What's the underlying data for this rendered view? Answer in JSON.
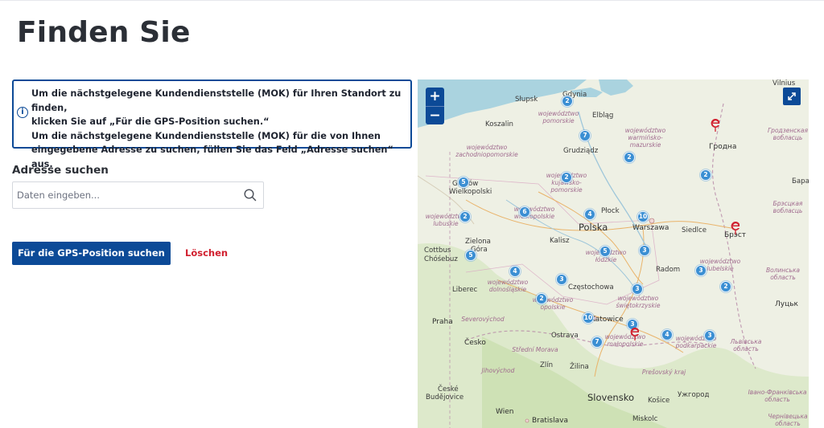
{
  "page": {
    "title": "Finden Sie"
  },
  "info": {
    "line1": "Um die nächstgelegene Kundendienststelle (MOK) für Ihren Standort zu finden,",
    "line2": "klicken Sie auf „Für die GPS-Position suchen.“",
    "line3": "Um die nächstgelegene Kundendienststelle (MOK) für die von Ihnen",
    "line4": "eingegebene Adresse zu suchen, füllen Sie das Feld „Adresse suchen“ aus."
  },
  "search": {
    "label": "Adresse suchen",
    "placeholder": "Daten eingeben..."
  },
  "actions": {
    "gps_label": "Für die GPS-Position suchen",
    "clear_label": "Löschen"
  },
  "map": {
    "zoom_in": "+",
    "zoom_out": "−",
    "labels": {
      "vilnius": "Vilnius",
      "gdynia": "Gdynia",
      "slupsk": "Słupsk",
      "elblag": "Elbląg",
      "koszalin": "Koszalin",
      "grodno": "Гродна",
      "grudziadz": "Grudziądz",
      "gorzow": "Gorzów",
      "wielkopolski": "Wielkopolski",
      "plock": "Płock",
      "polska": "Polska",
      "warszawa": "Warszawa",
      "siedlce": "Siedlce",
      "brest": "Брэст",
      "kalisz": "Kalisz",
      "zielona": "Zielona",
      "gora": "Góra",
      "cottbus": "Cottbus",
      "chosebuz": "Chóśebuz",
      "radom": "Radom",
      "liberec": "Liberec",
      "czestochowa": "Częstochowa",
      "lutsk": "Луцьк",
      "praha": "Praha",
      "katowice": "Katowice",
      "ostrava": "Ostrava",
      "cesko": "Česko",
      "zilina": "Žilina",
      "zlin": "Zlín",
      "slovensko": "Slovensko",
      "kosice": "Košice",
      "uzhhorod": "Ужгород",
      "ceske": "České",
      "budejovice": "Budějovice",
      "wien": "Wien",
      "bratislava": "Bratislava",
      "miskolc": "Miskolc",
      "bara": "Бара",
      "r_pomorskie": "województwo pomorskie",
      "r_warminsko": "województwo warmińsko-mazurskie",
      "r_zachodnio": "województwo zachodniopomorskie",
      "r_kujawsko": "województwo kujawsko-pomorskie",
      "r_lubuskie": "województwo lubuskie",
      "r_wielkopolskie": "województwo wielkopolskie",
      "r_lodzkie": "województwo łódzkie",
      "r_dolnoslaskie": "województwo dolnośląskie",
      "r_opolskie": "województwo opolskie",
      "r_swietokrzyskie": "województwo świętokrzyskie",
      "r_lubelskie": "województwo lubelskie",
      "r_malopolskie": "województwo małopolskie",
      "r_podkarpackie": "województwo podkarpackie",
      "r_grodzenska": "Гродзенская вобласць",
      "r_brestska": "Брэсцкая вобласць",
      "r_volynska": "Волинська область",
      "r_lvivska": "Львівська область",
      "r_ivano": "Івано-Франківська область",
      "r_chernivetska": "Чернівецька область",
      "r_severo": "Severovýchod",
      "r_stredni": "Střední Morava",
      "r_jihovychod": "Jihovýchod",
      "r_presov": "Prešovský kraj"
    },
    "clusters": [
      "2",
      "7",
      "2",
      "2",
      "5",
      "2",
      "2",
      "6",
      "4",
      "10",
      "2",
      "5",
      "5",
      "3",
      "4",
      "3",
      "3",
      "3",
      "2",
      "3",
      "10",
      "7",
      "4",
      "3"
    ],
    "colors": {
      "cluster": "#3b8fd3",
      "pin": "#d1202f",
      "water": "#aad3df",
      "accent": "#0c4a97"
    }
  }
}
